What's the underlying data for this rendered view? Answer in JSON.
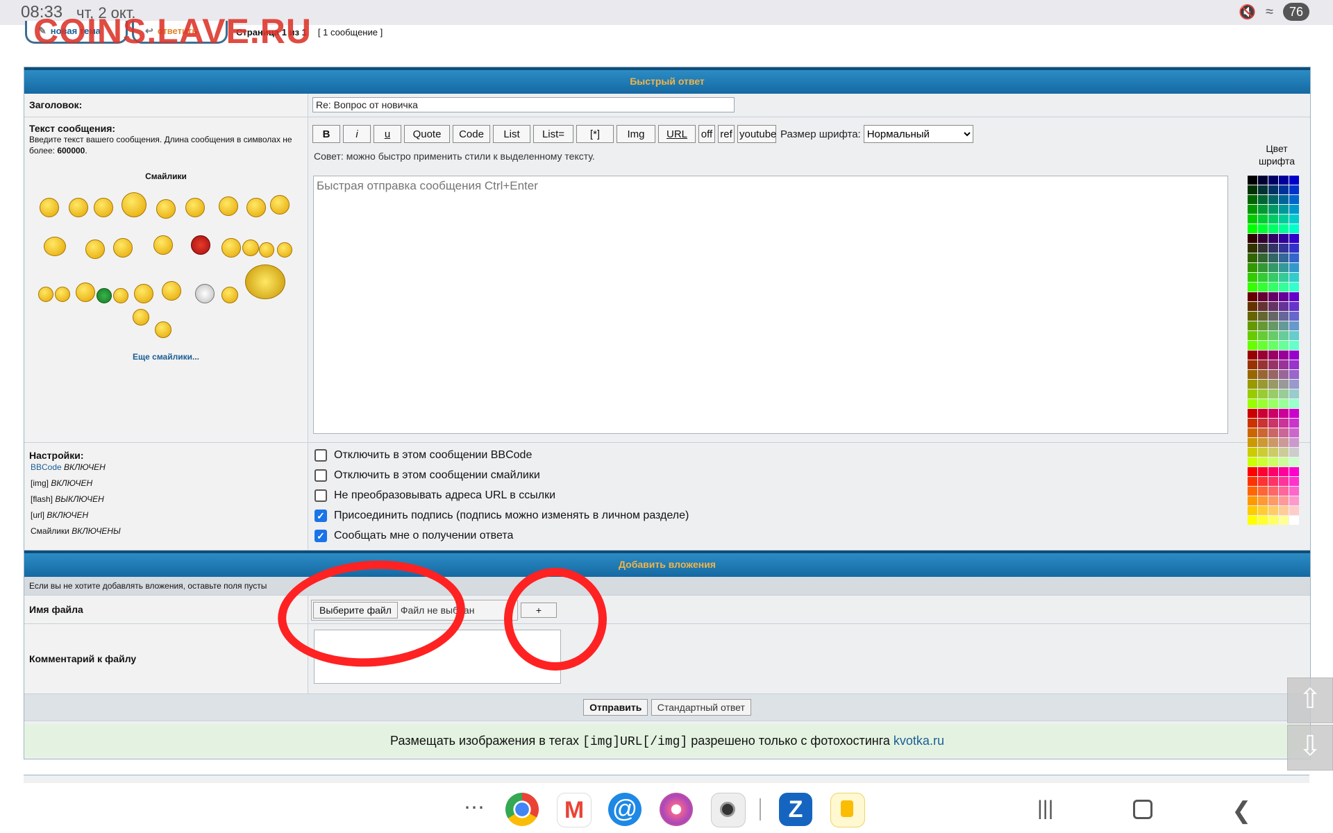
{
  "status_bar": {
    "time": "08:33",
    "date": "чт, 2 окт.",
    "battery": "76"
  },
  "watermark": "COINS.LAVE.RU",
  "top_nav": {
    "new_topic": "новая тема",
    "reply": "ответить",
    "page_info": "Страница 1 из 1",
    "message_count": "[ 1 сообщение ]"
  },
  "quick_reply": {
    "header": "Быстрый ответ",
    "subject_label": "Заголовок:",
    "subject_value": "Re: Вопрос от новичка",
    "message_label": "Текст сообщения:",
    "message_hint": "Введите текст вашего сообщения. Длина сообщения в символах не более:",
    "message_limit": "600000",
    "smilies_title": "Смайлики",
    "more_smilies": "Еще смайлики...",
    "bbcode_buttons": [
      "B",
      "i",
      "u",
      "Quote",
      "Code",
      "List",
      "List=",
      "[*]",
      "Img",
      "URL",
      "off",
      "ref",
      "youtube"
    ],
    "font_size_label": "Размер шрифта:",
    "font_size_value": "Нормальный",
    "tip": "Совет: можно быстро применить стили к выделенному тексту.",
    "message_placeholder": "Быстрая отправка сообщения Ctrl+Enter",
    "font_color_label_1": "Цвет",
    "font_color_label_2": "шрифта"
  },
  "settings": {
    "label": "Настройки:",
    "bbcode_link": "BBCode",
    "bbcode_state": "ВКЛЮЧЕН",
    "img_tag": "[img]",
    "img_state": "ВКЛЮЧЕН",
    "flash_tag": "[flash]",
    "flash_state": "ВЫКЛЮЧЕН",
    "url_tag": "[url]",
    "url_state": "ВКЛЮЧЕН",
    "smilies_word": "Смайлики",
    "smilies_state": "ВКЛЮЧЕНЫ",
    "options": [
      {
        "label": "Отключить в этом сообщении BBCode",
        "checked": false
      },
      {
        "label": "Отключить в этом сообщении смайлики",
        "checked": false
      },
      {
        "label": "Не преобразовывать адреса URL в ссылки",
        "checked": false
      },
      {
        "label": "Присоединить подпись (подпись можно изменять в личном разделе)",
        "checked": true
      },
      {
        "label": "Сообщать мне о получении ответа",
        "checked": true
      }
    ]
  },
  "attachments": {
    "header": "Добавить вложения",
    "note": "Если вы не хотите добавлять вложения, оставьте поля пусты",
    "file_label": "Имя файла",
    "choose_button": "Выберите файл",
    "no_file": "Файл не выбран",
    "add_button": "+",
    "comment_label": "Комментарий к файлу"
  },
  "actions": {
    "submit": "Отправить",
    "standard": "Стандартный ответ"
  },
  "notice": {
    "text_before": "Размещать изображения в тегах",
    "tag_example": "[img]URL[/img]",
    "text_after": "разрешено только с фотохостинга",
    "link": "kvotka.ru"
  },
  "icons": {
    "scroll_up": "arrow-up-icon",
    "scroll_down": "arrow-down-icon",
    "color_palette": [
      "#000000",
      "#000033",
      "#000066",
      "#000099",
      "#0000cc",
      "#003300",
      "#003333",
      "#003366",
      "#003399",
      "#0033cc",
      "#006600",
      "#006633",
      "#006666",
      "#006699",
      "#0066cc",
      "#009900",
      "#009933",
      "#009966",
      "#009999",
      "#0099cc",
      "#00cc00",
      "#00cc33",
      "#00cc66",
      "#00cc99",
      "#00cccc",
      "#00ff00",
      "#00ff33",
      "#00ff66",
      "#00ff99",
      "#00ffcc",
      "#330000",
      "#330033",
      "#330066",
      "#330099",
      "#3300cc",
      "#333300",
      "#333333",
      "#333366",
      "#333399",
      "#3333cc",
      "#336600",
      "#336633",
      "#336666",
      "#336699",
      "#3366cc",
      "#339900",
      "#339933",
      "#339966",
      "#339999",
      "#3399cc",
      "#33cc00",
      "#33cc33",
      "#33cc66",
      "#33cc99",
      "#33cccc",
      "#33ff00",
      "#33ff33",
      "#33ff66",
      "#33ff99",
      "#33ffcc",
      "#660000",
      "#660033",
      "#660066",
      "#660099",
      "#6600cc",
      "#663300",
      "#663333",
      "#663366",
      "#663399",
      "#6633cc",
      "#666600",
      "#666633",
      "#666666",
      "#666699",
      "#6666cc",
      "#669900",
      "#669933",
      "#669966",
      "#669999",
      "#6699cc",
      "#66cc00",
      "#66cc33",
      "#66cc66",
      "#66cc99",
      "#66cccc",
      "#66ff00",
      "#66ff33",
      "#66ff66",
      "#66ff99",
      "#66ffcc",
      "#990000",
      "#990033",
      "#990066",
      "#990099",
      "#9900cc",
      "#993300",
      "#993333",
      "#993366",
      "#993399",
      "#9933cc",
      "#996600",
      "#996633",
      "#996666",
      "#996699",
      "#9966cc",
      "#999900",
      "#999933",
      "#999966",
      "#999999",
      "#9999cc",
      "#99cc00",
      "#99cc33",
      "#99cc66",
      "#99cc99",
      "#99cccc",
      "#99ff00",
      "#99ff33",
      "#99ff66",
      "#99ff99",
      "#99ffcc",
      "#cc0000",
      "#cc0033",
      "#cc0066",
      "#cc0099",
      "#cc00cc",
      "#cc3300",
      "#cc3333",
      "#cc3366",
      "#cc3399",
      "#cc33cc",
      "#cc6600",
      "#cc6633",
      "#cc6666",
      "#cc6699",
      "#cc66cc",
      "#cc9900",
      "#cc9933",
      "#cc9966",
      "#cc9999",
      "#cc99cc",
      "#cccc00",
      "#cccc33",
      "#cccc66",
      "#cccc99",
      "#cccccc",
      "#ccff00",
      "#ccff33",
      "#ccff66",
      "#ccff99",
      "#ccffcc",
      "#ff0000",
      "#ff0033",
      "#ff0066",
      "#ff0099",
      "#ff00cc",
      "#ff3300",
      "#ff3333",
      "#ff3366",
      "#ff3399",
      "#ff33cc",
      "#ff6600",
      "#ff6633",
      "#ff6666",
      "#ff6699",
      "#ff66cc",
      "#ff9900",
      "#ff9933",
      "#ff9966",
      "#ff9999",
      "#ff99cc",
      "#ffcc00",
      "#ffcc33",
      "#ffcc66",
      "#ffcc99",
      "#ffcccc",
      "#ffff00",
      "#ffff33",
      "#ffff66",
      "#ffff99",
      "#ffffff"
    ]
  }
}
